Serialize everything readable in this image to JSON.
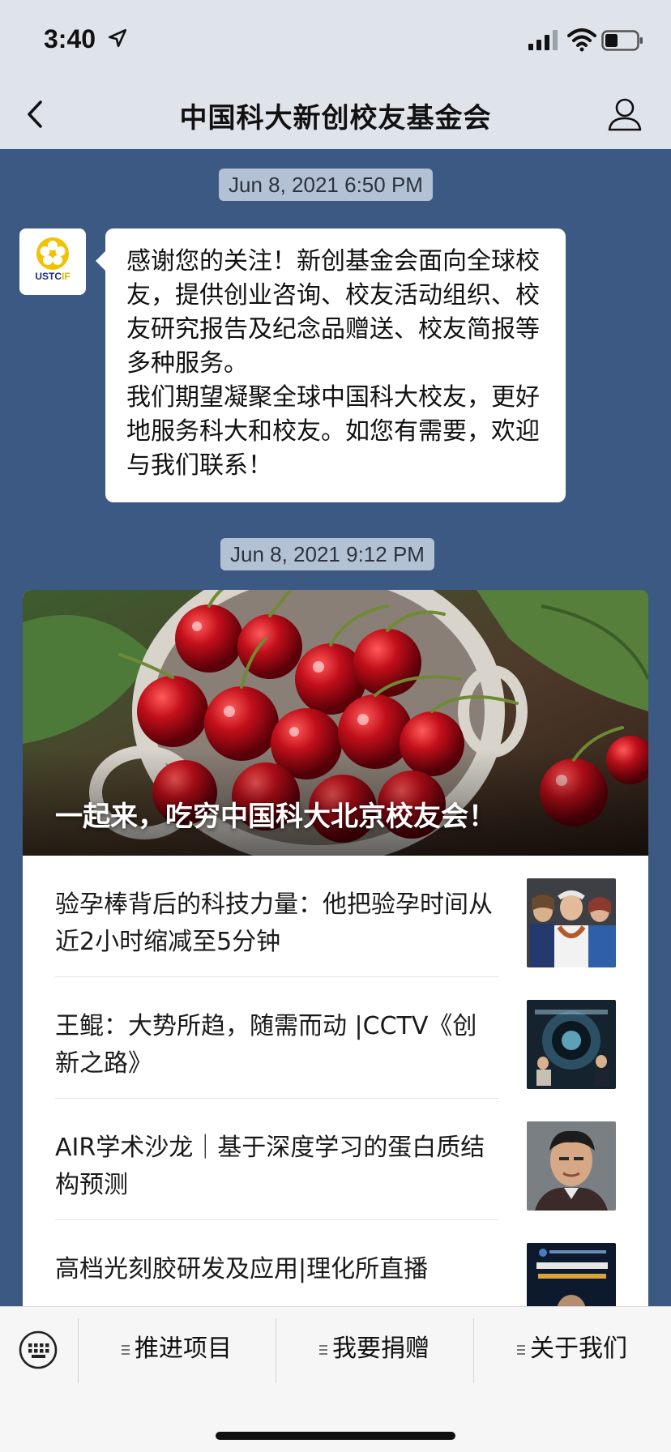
{
  "status_bar": {
    "time": "3:40",
    "icons": [
      "location-arrow-icon",
      "cellular-signal-icon",
      "wifi-icon",
      "battery-icon"
    ]
  },
  "nav": {
    "title": "中国科大新创校友基金会",
    "icons": [
      "back-chevron-icon",
      "profile-icon"
    ]
  },
  "chat": {
    "background": "#3b5982",
    "timestamp_1": "Jun 8, 2021 6:50 PM",
    "avatar_text_main": "USTC",
    "avatar_text_accent": "IF",
    "message": "感谢您的关注！新创基金会面向全球校友，提供创业咨询、校友活动组织、校友研究报告及纪念品赠送、校友简报等多种服务。\n我们期望凝聚全球中国科大校友，更好地服务科大和校友。如您有需要，欢迎与我们联系！",
    "timestamp_2": "Jun 8, 2021 9:12 PM"
  },
  "card": {
    "cover_title": "一起来，吃穷中国科大北京校友会！",
    "articles": [
      {
        "title": "验孕棒背后的科技力量：他把验孕时间从近2小时缩减至5分钟"
      },
      {
        "title": "王鲲：大势所趋，随需而动 |CCTV《创新之路》"
      },
      {
        "title": "AIR学术沙龙｜基于深度学习的蛋白质结构预测"
      },
      {
        "title": "高档光刻胶研发及应用|理化所直播"
      }
    ]
  },
  "menu": {
    "items": [
      {
        "label": "推进项目"
      },
      {
        "label": "我要捐赠"
      },
      {
        "label": "关于我们"
      }
    ],
    "icons": [
      "keyboard-icon",
      "menu-hamburger-icon"
    ]
  }
}
